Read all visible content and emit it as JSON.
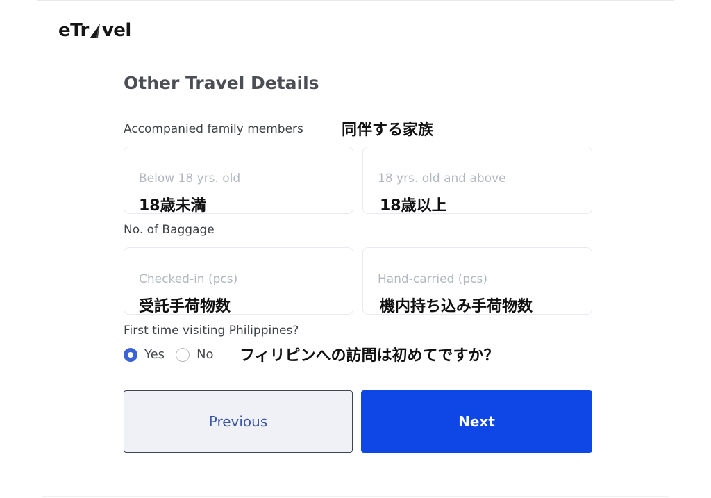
{
  "brand": {
    "logo_pre": "eTr",
    "logo_post": "vel"
  },
  "form": {
    "title": "Other Travel Details",
    "family": {
      "label": "Accompanied family members",
      "annotation": "同伴する家族",
      "below18": {
        "placeholder": "Below 18 yrs. old",
        "annotation": "18歳未満"
      },
      "above18": {
        "placeholder": "18 yrs. old and above",
        "annotation": "18歳以上"
      }
    },
    "baggage": {
      "label": "No. of Baggage",
      "checked": {
        "placeholder": "Checked-in (pcs)",
        "annotation": "受託手荷物数"
      },
      "hand": {
        "placeholder": "Hand-carried (pcs)",
        "annotation": "機内持ち込み手荷物数"
      }
    },
    "first_time": {
      "label": "First time visiting Philippines?",
      "yes": "Yes",
      "no": "No",
      "selected": "Yes",
      "annotation": "フィリピンへの訪問は初めてですか？"
    },
    "buttons": {
      "previous": "Previous",
      "next": "Next"
    }
  },
  "colors": {
    "primary": "#0f46e6",
    "radio_selected": "#3b63d6",
    "field_border": "#e7ebf1",
    "placeholder": "#b2b8c0"
  }
}
